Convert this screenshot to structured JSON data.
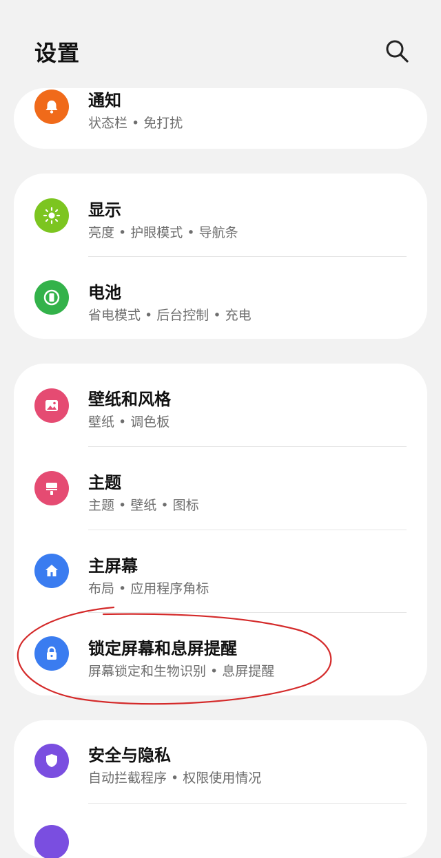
{
  "header": {
    "title": "设置",
    "search_icon": "search-icon"
  },
  "colors": {
    "notifications": "#f06a1a",
    "display": "#7cc520",
    "battery": "#33b24a",
    "wallpaper": "#e54b72",
    "themes": "#e54b72",
    "home": "#3a7cf0",
    "lock": "#3a7cf0",
    "security": "#7a4ee0",
    "annotation_circle": "#d42a2a"
  },
  "items": {
    "notifications": {
      "title": "通知",
      "subtitle": "状态栏 • 免打扰",
      "icon": "bell-icon"
    },
    "display": {
      "title": "显示",
      "subtitle": "亮度 • 护眼模式 • 导航条",
      "icon": "sun-icon"
    },
    "battery": {
      "title": "电池",
      "subtitle": "省电模式 • 后台控制 • 充电",
      "icon": "battery-icon"
    },
    "wallpaper": {
      "title": "壁纸和风格",
      "subtitle": "壁纸 • 调色板",
      "icon": "image-icon"
    },
    "themes": {
      "title": "主题",
      "subtitle": "主题 • 壁纸 • 图标",
      "icon": "paint-roller-icon"
    },
    "home": {
      "title": "主屏幕",
      "subtitle": "布局 • 应用程序角标",
      "icon": "home-icon"
    },
    "lock": {
      "title": "锁定屏幕和息屏提醒",
      "subtitle": "屏幕锁定和生物识别 • 息屏提醒",
      "icon": "lock-icon"
    },
    "security": {
      "title": "安全与隐私",
      "subtitle": "自动拦截程序 • 权限使用情况",
      "icon": "shield-icon"
    }
  }
}
